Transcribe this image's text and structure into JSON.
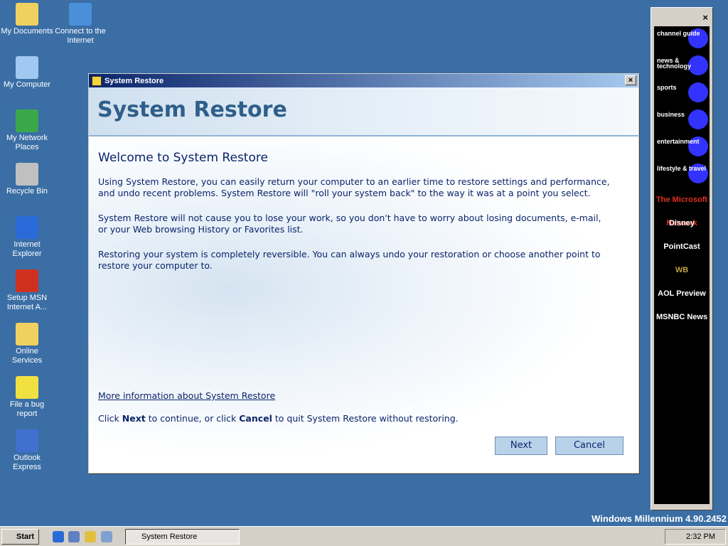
{
  "desktop": {
    "icons": [
      {
        "label": "My Documents",
        "color": "#f0d060"
      },
      {
        "label": "Connect to the Internet",
        "color": "#4a90d9"
      },
      {
        "label": "My Computer",
        "color": "#a0c8f0"
      },
      {
        "label": "My Network Places",
        "color": "#3aa84a"
      },
      {
        "label": "Recycle Bin",
        "color": "#c0c0c0"
      },
      {
        "label": "Internet Explorer",
        "color": "#2a6ad8"
      },
      {
        "label": "Setup MSN Internet A...",
        "color": "#d03020"
      },
      {
        "label": "Online Services",
        "color": "#f0d060"
      },
      {
        "label": "File a bug report",
        "color": "#f0e040"
      },
      {
        "label": "Outlook Express",
        "color": "#4070d0"
      }
    ],
    "version": "Windows Millennium 4.90.2452"
  },
  "dialog": {
    "title": "System Restore",
    "close": "×",
    "header": "System Restore",
    "heading": "Welcome to System Restore",
    "paragraphs": [
      "Using System Restore, you can easily return your computer to an earlier time to restore settings and performance, and undo recent problems. System Restore will \"roll your system back\" to the way it was at a point you select.",
      "System Restore will not cause you to lose your work, so you don't have to worry about losing documents, e-mail, or your Web browsing History or Favorites list.",
      "Restoring your system is completely reversible. You can always undo your restoration or choose another point to restore your computer to."
    ],
    "link": "More information about System Restore",
    "footer": {
      "a": "Click ",
      "next": "Next",
      "b": " to continue, or click ",
      "cancel": "Cancel",
      "c": " to quit System Restore without restoring."
    },
    "next_label": "Next",
    "cancel_label": "Cancel"
  },
  "channel_bar": {
    "close": "×",
    "channels": [
      "channel guide",
      "news & technology",
      "sports",
      "business",
      "entertainment",
      "lifestyle & travel"
    ],
    "logos": [
      "The Microsoft Network",
      "Disney",
      "PointCast",
      "WB",
      "AOL Preview",
      "MSNBC News"
    ]
  },
  "taskbar": {
    "start": "Start",
    "task": "System Restore",
    "clock": "2:32 PM"
  }
}
